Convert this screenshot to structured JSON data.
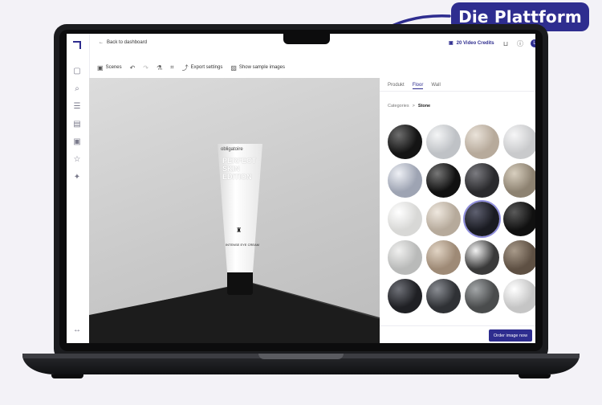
{
  "callout": {
    "label": "Die Plattform"
  },
  "topbar": {
    "back_label": "Back to dashboard",
    "credits_label": "20 Video Credits",
    "avatar_initial": "L"
  },
  "toolbar": {
    "scenes_label": "Scenes",
    "export_label": "Export settings",
    "samples_label": "Show sample images"
  },
  "product": {
    "brand": "obligatoire",
    "headline": "PERFECT SKIN EDITION",
    "subline": "INTENSE EYE CREAM"
  },
  "panel": {
    "tabs": [
      {
        "label": "Produkt",
        "active": false
      },
      {
        "label": "Floor",
        "active": true
      },
      {
        "label": "Wall",
        "active": false
      }
    ],
    "breadcrumb": {
      "root": "Categories",
      "separator": ">",
      "current": "Stone"
    },
    "materials": [
      {
        "color": "#141414",
        "highlight": "#6e6e6e",
        "selected": false
      },
      {
        "color": "#bfc2c6",
        "highlight": "#f4f5f6",
        "selected": false
      },
      {
        "color": "#b7aa9b",
        "highlight": "#eae3da",
        "selected": false
      },
      {
        "color": "#c9cacc",
        "highlight": "#f6f6f7",
        "selected": false
      },
      {
        "color": "#9ea4b3",
        "highlight": "#eef0f5",
        "selected": false
      },
      {
        "color": "#111111",
        "highlight": "#777777",
        "selected": false
      },
      {
        "color": "#2a2a2d",
        "highlight": "#7b7b80",
        "selected": false
      },
      {
        "color": "#8d8271",
        "highlight": "#d8cfbf",
        "selected": false
      },
      {
        "color": "#d8d8d6",
        "highlight": "#ffffff",
        "selected": false
      },
      {
        "color": "#b6aa9b",
        "highlight": "#efe8df",
        "selected": false
      },
      {
        "color": "#1a1b22",
        "highlight": "#5e6070",
        "selected": true
      },
      {
        "color": "#101010",
        "highlight": "#5a5a5a",
        "selected": false
      },
      {
        "color": "#b9bab9",
        "highlight": "#f0f0ef",
        "selected": false
      },
      {
        "color": "#9e8a76",
        "highlight": "#e1d4c4",
        "selected": false
      },
      {
        "color": "#3a3a3a",
        "highlight": "#f2f2f2",
        "selected": false
      },
      {
        "color": "#5e5043",
        "highlight": "#a89a8a",
        "selected": false
      },
      {
        "color": "#1f2024",
        "highlight": "#6f7178",
        "selected": false
      },
      {
        "color": "#2f3135",
        "highlight": "#8a8d93",
        "selected": false
      },
      {
        "color": "#4a4c4d",
        "highlight": "#a3a6a8",
        "selected": false
      },
      {
        "color": "#c5c5c5",
        "highlight": "#ffffff",
        "selected": false
      }
    ],
    "order_label": "Order image now"
  },
  "colors": {
    "brand": "#2e2d8f",
    "selection": "#8f8edc"
  }
}
